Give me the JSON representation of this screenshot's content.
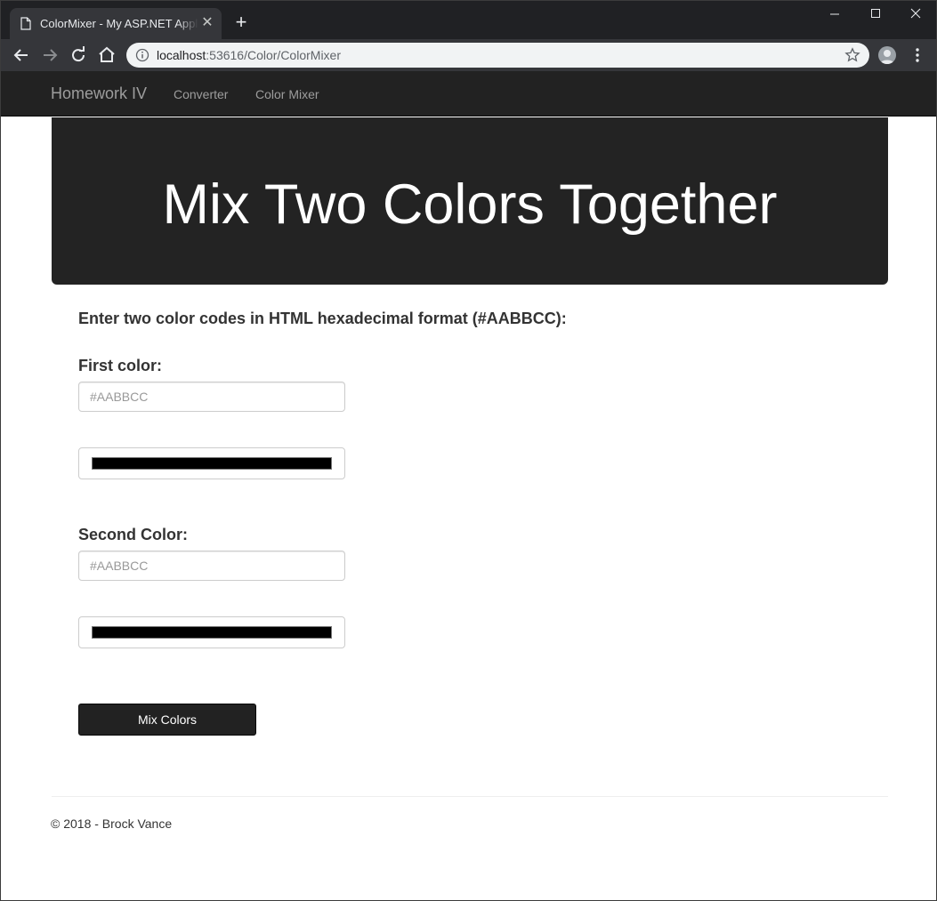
{
  "browser": {
    "tab_title": "ColorMixer - My ASP.NET Application",
    "tab_close": "✕",
    "new_tab": "+",
    "url_host": "localhost",
    "url_rest": ":53616/Color/ColorMixer"
  },
  "navbar": {
    "brand": "Homework IV",
    "links": [
      "Converter",
      "Color Mixer"
    ]
  },
  "jumbotron": {
    "heading": "Mix Two Colors Together"
  },
  "form": {
    "instructions": "Enter two color codes in HTML hexadecimal format (#AABBCC):",
    "first_label": "First color:",
    "first_placeholder": "#AABBCC",
    "first_picker_value": "#000000",
    "second_label": "Second Color:",
    "second_placeholder": "#AABBCC",
    "second_picker_value": "#000000",
    "submit_label": "Mix Colors"
  },
  "footer": {
    "text": "© 2018 - Brock Vance"
  },
  "colors": {
    "navbar_bg": "#222222",
    "jumbotron_bg": "#232323",
    "button_bg": "#222222"
  }
}
